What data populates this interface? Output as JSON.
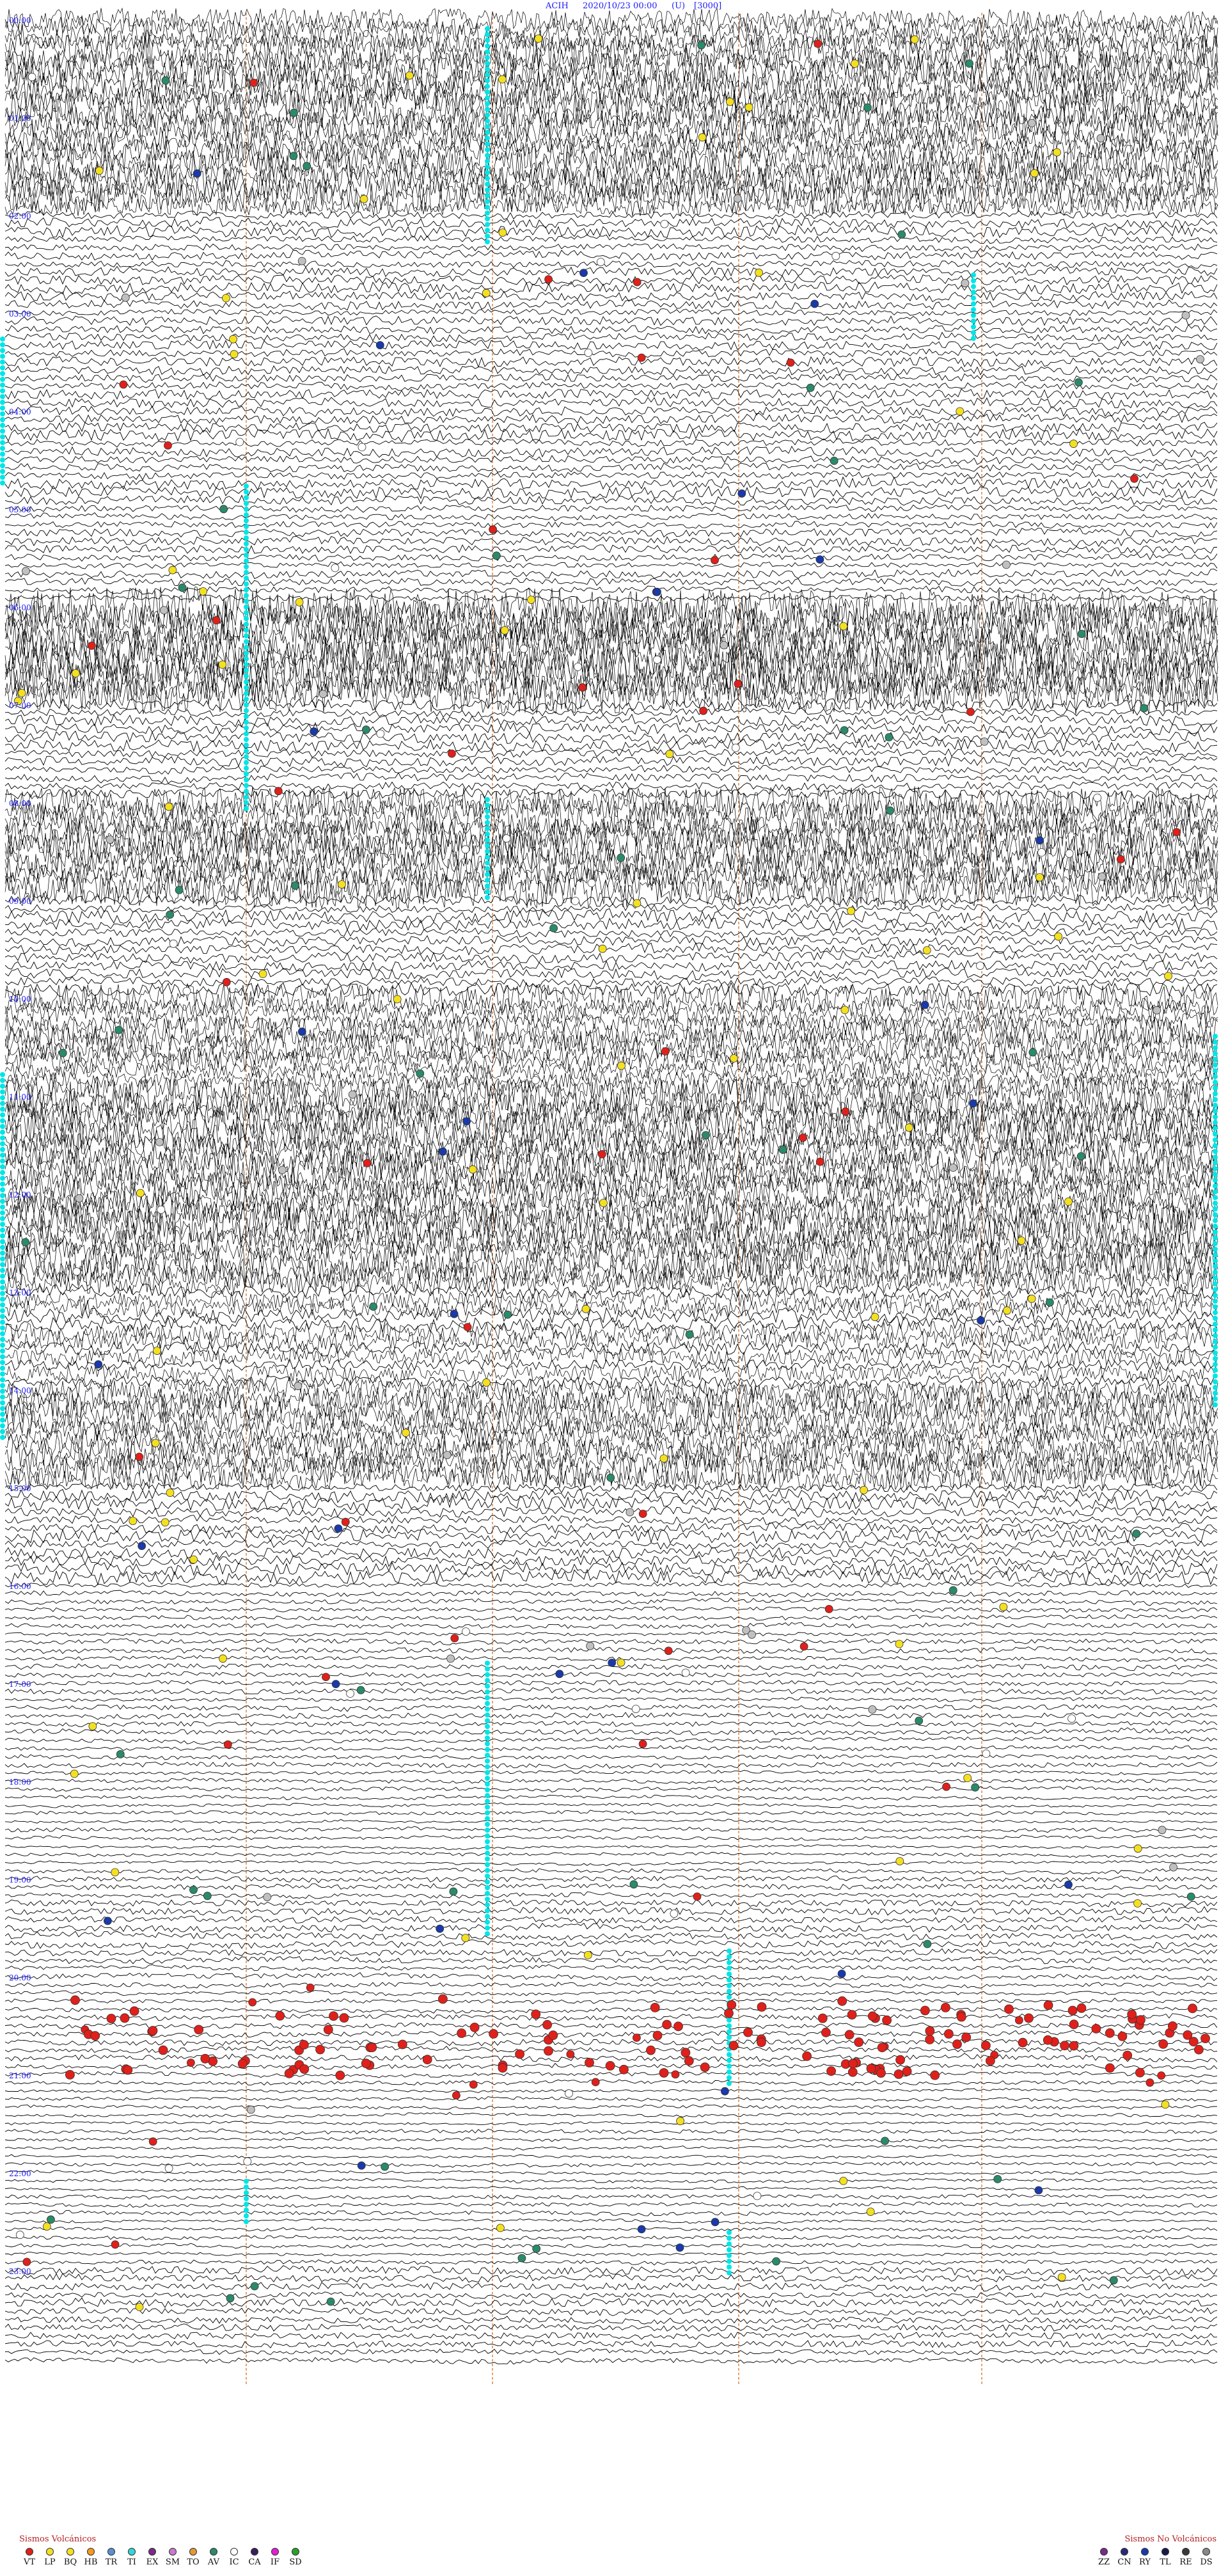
{
  "header": {
    "station": "ACIH",
    "date": "2020/10/23 00:00",
    "component": "(U)",
    "scale": "[3000]"
  },
  "hour_labels": [
    "00:00",
    "01:00",
    "02:00",
    "03:00",
    "04:00",
    "05:00",
    "06:00",
    "07:00",
    "08:00",
    "09:00",
    "10:00",
    "11:00",
    "12:00",
    "13:00",
    "14:00",
    "15:00",
    "16:00",
    "17:00",
    "18:00",
    "19:00",
    "20:00",
    "21:00",
    "22:00",
    "23:00"
  ],
  "colors": {
    "trace": "#000000",
    "minute_marker": "#d2691e",
    "header_text": "#1a1aff",
    "calibration": "#00e5e5"
  },
  "legend_volcanic": {
    "title": "Sismos Volcánicos",
    "items": [
      {
        "code": "VT",
        "color": "#e0201a"
      },
      {
        "code": "LP",
        "color": "#f5e020"
      },
      {
        "code": "BQ",
        "color": "#f5e020"
      },
      {
        "code": "HB",
        "color": "#f59a1a"
      },
      {
        "code": "TR",
        "color": "#5a8fd0"
      },
      {
        "code": "TI",
        "color": "#33d6d6"
      },
      {
        "code": "EX",
        "color": "#7a2a8a"
      },
      {
        "code": "SM",
        "color": "#c77ad0"
      },
      {
        "code": "TO",
        "color": "#e09a3a"
      },
      {
        "code": "AV",
        "color": "#2a8a6a"
      },
      {
        "code": "IC",
        "color": "#ffffff"
      },
      {
        "code": "CA",
        "color": "#3a1f5a"
      },
      {
        "code": "IF",
        "color": "#e020d0"
      },
      {
        "code": "SD",
        "color": "#2aa02a"
      }
    ]
  },
  "legend_nonvolcanic": {
    "title": "Sismos No Volcánicos",
    "items": [
      {
        "code": "ZZ",
        "color": "#7a2a8a"
      },
      {
        "code": "CN",
        "color": "#2a2a7a"
      },
      {
        "code": "RY",
        "color": "#1a3aaa"
      },
      {
        "code": "TL",
        "color": "#1a1a4a"
      },
      {
        "code": "RE",
        "color": "#3a3a3a"
      },
      {
        "code": "DS",
        "color": "#888888"
      }
    ]
  }
}
